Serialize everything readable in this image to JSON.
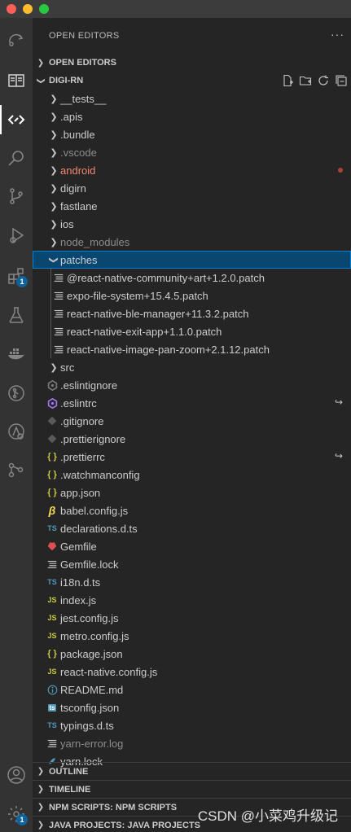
{
  "explorer": {
    "title": "OPEN EDITORS",
    "more_label": "···",
    "open_editors_label": "OPEN EDITORS",
    "project_label": "DIGI-RN"
  },
  "tree": [
    {
      "label": "__tests__",
      "type": "folder",
      "depth": 0,
      "style": "normal"
    },
    {
      "label": ".apis",
      "type": "folder",
      "depth": 0,
      "style": "normal"
    },
    {
      "label": ".bundle",
      "type": "folder",
      "depth": 0,
      "style": "normal"
    },
    {
      "label": ".vscode",
      "type": "folder",
      "depth": 0,
      "style": "dim"
    },
    {
      "label": "android",
      "type": "folder",
      "depth": 0,
      "style": "red",
      "modified": true
    },
    {
      "label": "digirn",
      "type": "folder",
      "depth": 0,
      "style": "normal"
    },
    {
      "label": "fastlane",
      "type": "folder",
      "depth": 0,
      "style": "normal"
    },
    {
      "label": "ios",
      "type": "folder",
      "depth": 0,
      "style": "normal"
    },
    {
      "label": "node_modules",
      "type": "folder",
      "depth": 0,
      "style": "dim"
    },
    {
      "label": "patches",
      "type": "folder-open",
      "depth": 0,
      "style": "normal",
      "selected": true
    },
    {
      "label": "@react-native-community+art+1.2.0.patch",
      "type": "lines",
      "depth": 1,
      "style": "normal"
    },
    {
      "label": "expo-file-system+15.4.5.patch",
      "type": "lines",
      "depth": 1,
      "style": "normal"
    },
    {
      "label": "react-native-ble-manager+11.3.2.patch",
      "type": "lines",
      "depth": 1,
      "style": "normal"
    },
    {
      "label": "react-native-exit-app+1.1.0.patch",
      "type": "lines",
      "depth": 1,
      "style": "normal"
    },
    {
      "label": "react-native-image-pan-zoom+2.1.12.patch",
      "type": "lines",
      "depth": 1,
      "style": "normal"
    },
    {
      "label": "src",
      "type": "folder",
      "depth": 0,
      "style": "normal"
    },
    {
      "label": ".eslintignore",
      "type": "eslint-dim",
      "depth": 0,
      "style": "normal"
    },
    {
      "label": ".eslintrc",
      "type": "eslint",
      "depth": 0,
      "style": "normal",
      "link": true
    },
    {
      "label": ".gitignore",
      "type": "git",
      "depth": 0,
      "style": "normal"
    },
    {
      "label": ".prettierignore",
      "type": "git",
      "depth": 0,
      "style": "normal"
    },
    {
      "label": ".prettierrc",
      "type": "json",
      "depth": 0,
      "style": "normal",
      "link": true
    },
    {
      "label": ".watchmanconfig",
      "type": "json",
      "depth": 0,
      "style": "normal"
    },
    {
      "label": "app.json",
      "type": "json",
      "depth": 0,
      "style": "normal"
    },
    {
      "label": "babel.config.js",
      "type": "babel",
      "depth": 0,
      "style": "normal"
    },
    {
      "label": "declarations.d.ts",
      "type": "ts",
      "depth": 0,
      "style": "normal"
    },
    {
      "label": "Gemfile",
      "type": "ruby",
      "depth": 0,
      "style": "normal"
    },
    {
      "label": "Gemfile.lock",
      "type": "lines",
      "depth": 0,
      "style": "normal"
    },
    {
      "label": "i18n.d.ts",
      "type": "ts",
      "depth": 0,
      "style": "normal"
    },
    {
      "label": "index.js",
      "type": "js",
      "depth": 0,
      "style": "normal"
    },
    {
      "label": "jest.config.js",
      "type": "js",
      "depth": 0,
      "style": "normal"
    },
    {
      "label": "metro.config.js",
      "type": "js",
      "depth": 0,
      "style": "normal"
    },
    {
      "label": "package.json",
      "type": "json",
      "depth": 0,
      "style": "normal"
    },
    {
      "label": "react-native.config.js",
      "type": "js",
      "depth": 0,
      "style": "normal"
    },
    {
      "label": "README.md",
      "type": "info",
      "depth": 0,
      "style": "normal"
    },
    {
      "label": "tsconfig.json",
      "type": "tsconfig",
      "depth": 0,
      "style": "normal"
    },
    {
      "label": "typings.d.ts",
      "type": "ts",
      "depth": 0,
      "style": "normal"
    },
    {
      "label": "yarn-error.log",
      "type": "lines",
      "depth": 0,
      "style": "dim"
    },
    {
      "label": "yarn.lock",
      "type": "yarn",
      "depth": 0,
      "style": "normal"
    }
  ],
  "bottom_sections": [
    {
      "label": "OUTLINE"
    },
    {
      "label": "TIMELINE"
    },
    {
      "label": "NPM SCRIPTS: NPM SCRIPTS"
    },
    {
      "label": "JAVA PROJECTS: JAVA PROJECTS"
    }
  ],
  "activity": {
    "extensions_badge": "1",
    "settings_badge": "1"
  },
  "watermark": "CSDN @小菜鸡升级记",
  "colors": {
    "accent": "#0e639c",
    "selection_bg": "#094771",
    "modified": "#f48771"
  }
}
